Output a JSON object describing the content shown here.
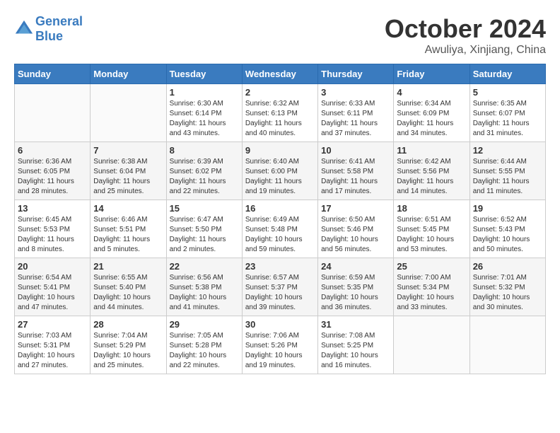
{
  "header": {
    "logo_line1": "General",
    "logo_line2": "Blue",
    "month": "October 2024",
    "location": "Awuliya, Xinjiang, China"
  },
  "weekdays": [
    "Sunday",
    "Monday",
    "Tuesday",
    "Wednesday",
    "Thursday",
    "Friday",
    "Saturday"
  ],
  "weeks": [
    [
      {
        "day": "",
        "info": ""
      },
      {
        "day": "",
        "info": ""
      },
      {
        "day": "1",
        "info": "Sunrise: 6:30 AM\nSunset: 6:14 PM\nDaylight: 11 hours\nand 43 minutes."
      },
      {
        "day": "2",
        "info": "Sunrise: 6:32 AM\nSunset: 6:13 PM\nDaylight: 11 hours\nand 40 minutes."
      },
      {
        "day": "3",
        "info": "Sunrise: 6:33 AM\nSunset: 6:11 PM\nDaylight: 11 hours\nand 37 minutes."
      },
      {
        "day": "4",
        "info": "Sunrise: 6:34 AM\nSunset: 6:09 PM\nDaylight: 11 hours\nand 34 minutes."
      },
      {
        "day": "5",
        "info": "Sunrise: 6:35 AM\nSunset: 6:07 PM\nDaylight: 11 hours\nand 31 minutes."
      }
    ],
    [
      {
        "day": "6",
        "info": "Sunrise: 6:36 AM\nSunset: 6:05 PM\nDaylight: 11 hours\nand 28 minutes."
      },
      {
        "day": "7",
        "info": "Sunrise: 6:38 AM\nSunset: 6:04 PM\nDaylight: 11 hours\nand 25 minutes."
      },
      {
        "day": "8",
        "info": "Sunrise: 6:39 AM\nSunset: 6:02 PM\nDaylight: 11 hours\nand 22 minutes."
      },
      {
        "day": "9",
        "info": "Sunrise: 6:40 AM\nSunset: 6:00 PM\nDaylight: 11 hours\nand 19 minutes."
      },
      {
        "day": "10",
        "info": "Sunrise: 6:41 AM\nSunset: 5:58 PM\nDaylight: 11 hours\nand 17 minutes."
      },
      {
        "day": "11",
        "info": "Sunrise: 6:42 AM\nSunset: 5:56 PM\nDaylight: 11 hours\nand 14 minutes."
      },
      {
        "day": "12",
        "info": "Sunrise: 6:44 AM\nSunset: 5:55 PM\nDaylight: 11 hours\nand 11 minutes."
      }
    ],
    [
      {
        "day": "13",
        "info": "Sunrise: 6:45 AM\nSunset: 5:53 PM\nDaylight: 11 hours\nand 8 minutes."
      },
      {
        "day": "14",
        "info": "Sunrise: 6:46 AM\nSunset: 5:51 PM\nDaylight: 11 hours\nand 5 minutes."
      },
      {
        "day": "15",
        "info": "Sunrise: 6:47 AM\nSunset: 5:50 PM\nDaylight: 11 hours\nand 2 minutes."
      },
      {
        "day": "16",
        "info": "Sunrise: 6:49 AM\nSunset: 5:48 PM\nDaylight: 10 hours\nand 59 minutes."
      },
      {
        "day": "17",
        "info": "Sunrise: 6:50 AM\nSunset: 5:46 PM\nDaylight: 10 hours\nand 56 minutes."
      },
      {
        "day": "18",
        "info": "Sunrise: 6:51 AM\nSunset: 5:45 PM\nDaylight: 10 hours\nand 53 minutes."
      },
      {
        "day": "19",
        "info": "Sunrise: 6:52 AM\nSunset: 5:43 PM\nDaylight: 10 hours\nand 50 minutes."
      }
    ],
    [
      {
        "day": "20",
        "info": "Sunrise: 6:54 AM\nSunset: 5:41 PM\nDaylight: 10 hours\nand 47 minutes."
      },
      {
        "day": "21",
        "info": "Sunrise: 6:55 AM\nSunset: 5:40 PM\nDaylight: 10 hours\nand 44 minutes."
      },
      {
        "day": "22",
        "info": "Sunrise: 6:56 AM\nSunset: 5:38 PM\nDaylight: 10 hours\nand 41 minutes."
      },
      {
        "day": "23",
        "info": "Sunrise: 6:57 AM\nSunset: 5:37 PM\nDaylight: 10 hours\nand 39 minutes."
      },
      {
        "day": "24",
        "info": "Sunrise: 6:59 AM\nSunset: 5:35 PM\nDaylight: 10 hours\nand 36 minutes."
      },
      {
        "day": "25",
        "info": "Sunrise: 7:00 AM\nSunset: 5:34 PM\nDaylight: 10 hours\nand 33 minutes."
      },
      {
        "day": "26",
        "info": "Sunrise: 7:01 AM\nSunset: 5:32 PM\nDaylight: 10 hours\nand 30 minutes."
      }
    ],
    [
      {
        "day": "27",
        "info": "Sunrise: 7:03 AM\nSunset: 5:31 PM\nDaylight: 10 hours\nand 27 minutes."
      },
      {
        "day": "28",
        "info": "Sunrise: 7:04 AM\nSunset: 5:29 PM\nDaylight: 10 hours\nand 25 minutes."
      },
      {
        "day": "29",
        "info": "Sunrise: 7:05 AM\nSunset: 5:28 PM\nDaylight: 10 hours\nand 22 minutes."
      },
      {
        "day": "30",
        "info": "Sunrise: 7:06 AM\nSunset: 5:26 PM\nDaylight: 10 hours\nand 19 minutes."
      },
      {
        "day": "31",
        "info": "Sunrise: 7:08 AM\nSunset: 5:25 PM\nDaylight: 10 hours\nand 16 minutes."
      },
      {
        "day": "",
        "info": ""
      },
      {
        "day": "",
        "info": ""
      }
    ]
  ]
}
